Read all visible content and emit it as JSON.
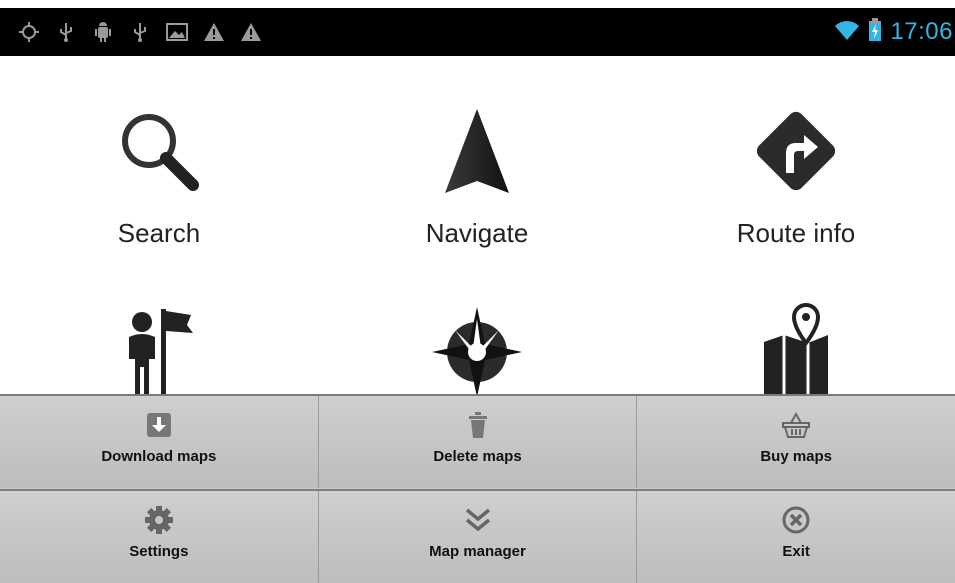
{
  "status_bar": {
    "icons": [
      "gps-icon",
      "usb-icon",
      "android-debug-icon",
      "usb-icon",
      "image-icon",
      "warning-icon",
      "warning-icon"
    ],
    "wifi": "wifi-icon",
    "battery": "battery-charging-icon",
    "time": "17:06",
    "accent_color": "#33b5e5"
  },
  "main_menu": {
    "items": [
      {
        "label": "Search",
        "icon": "search-icon"
      },
      {
        "label": "Navigate",
        "icon": "navigate-arrow-icon"
      },
      {
        "label": "Route info",
        "icon": "route-info-icon"
      },
      {
        "label": "",
        "icon": "person-flag-icon"
      },
      {
        "label": "",
        "icon": "compass-icon"
      },
      {
        "label": "",
        "icon": "map-pin-icon"
      }
    ]
  },
  "options_menu": {
    "row1": [
      {
        "label": "Download maps",
        "icon": "download-icon"
      },
      {
        "label": "Delete maps",
        "icon": "trash-icon"
      },
      {
        "label": "Buy maps",
        "icon": "basket-icon"
      }
    ],
    "row2": [
      {
        "label": "Settings",
        "icon": "gear-icon"
      },
      {
        "label": "Map manager",
        "icon": "chevrons-down-icon"
      },
      {
        "label": "Exit",
        "icon": "close-circle-icon"
      }
    ]
  }
}
